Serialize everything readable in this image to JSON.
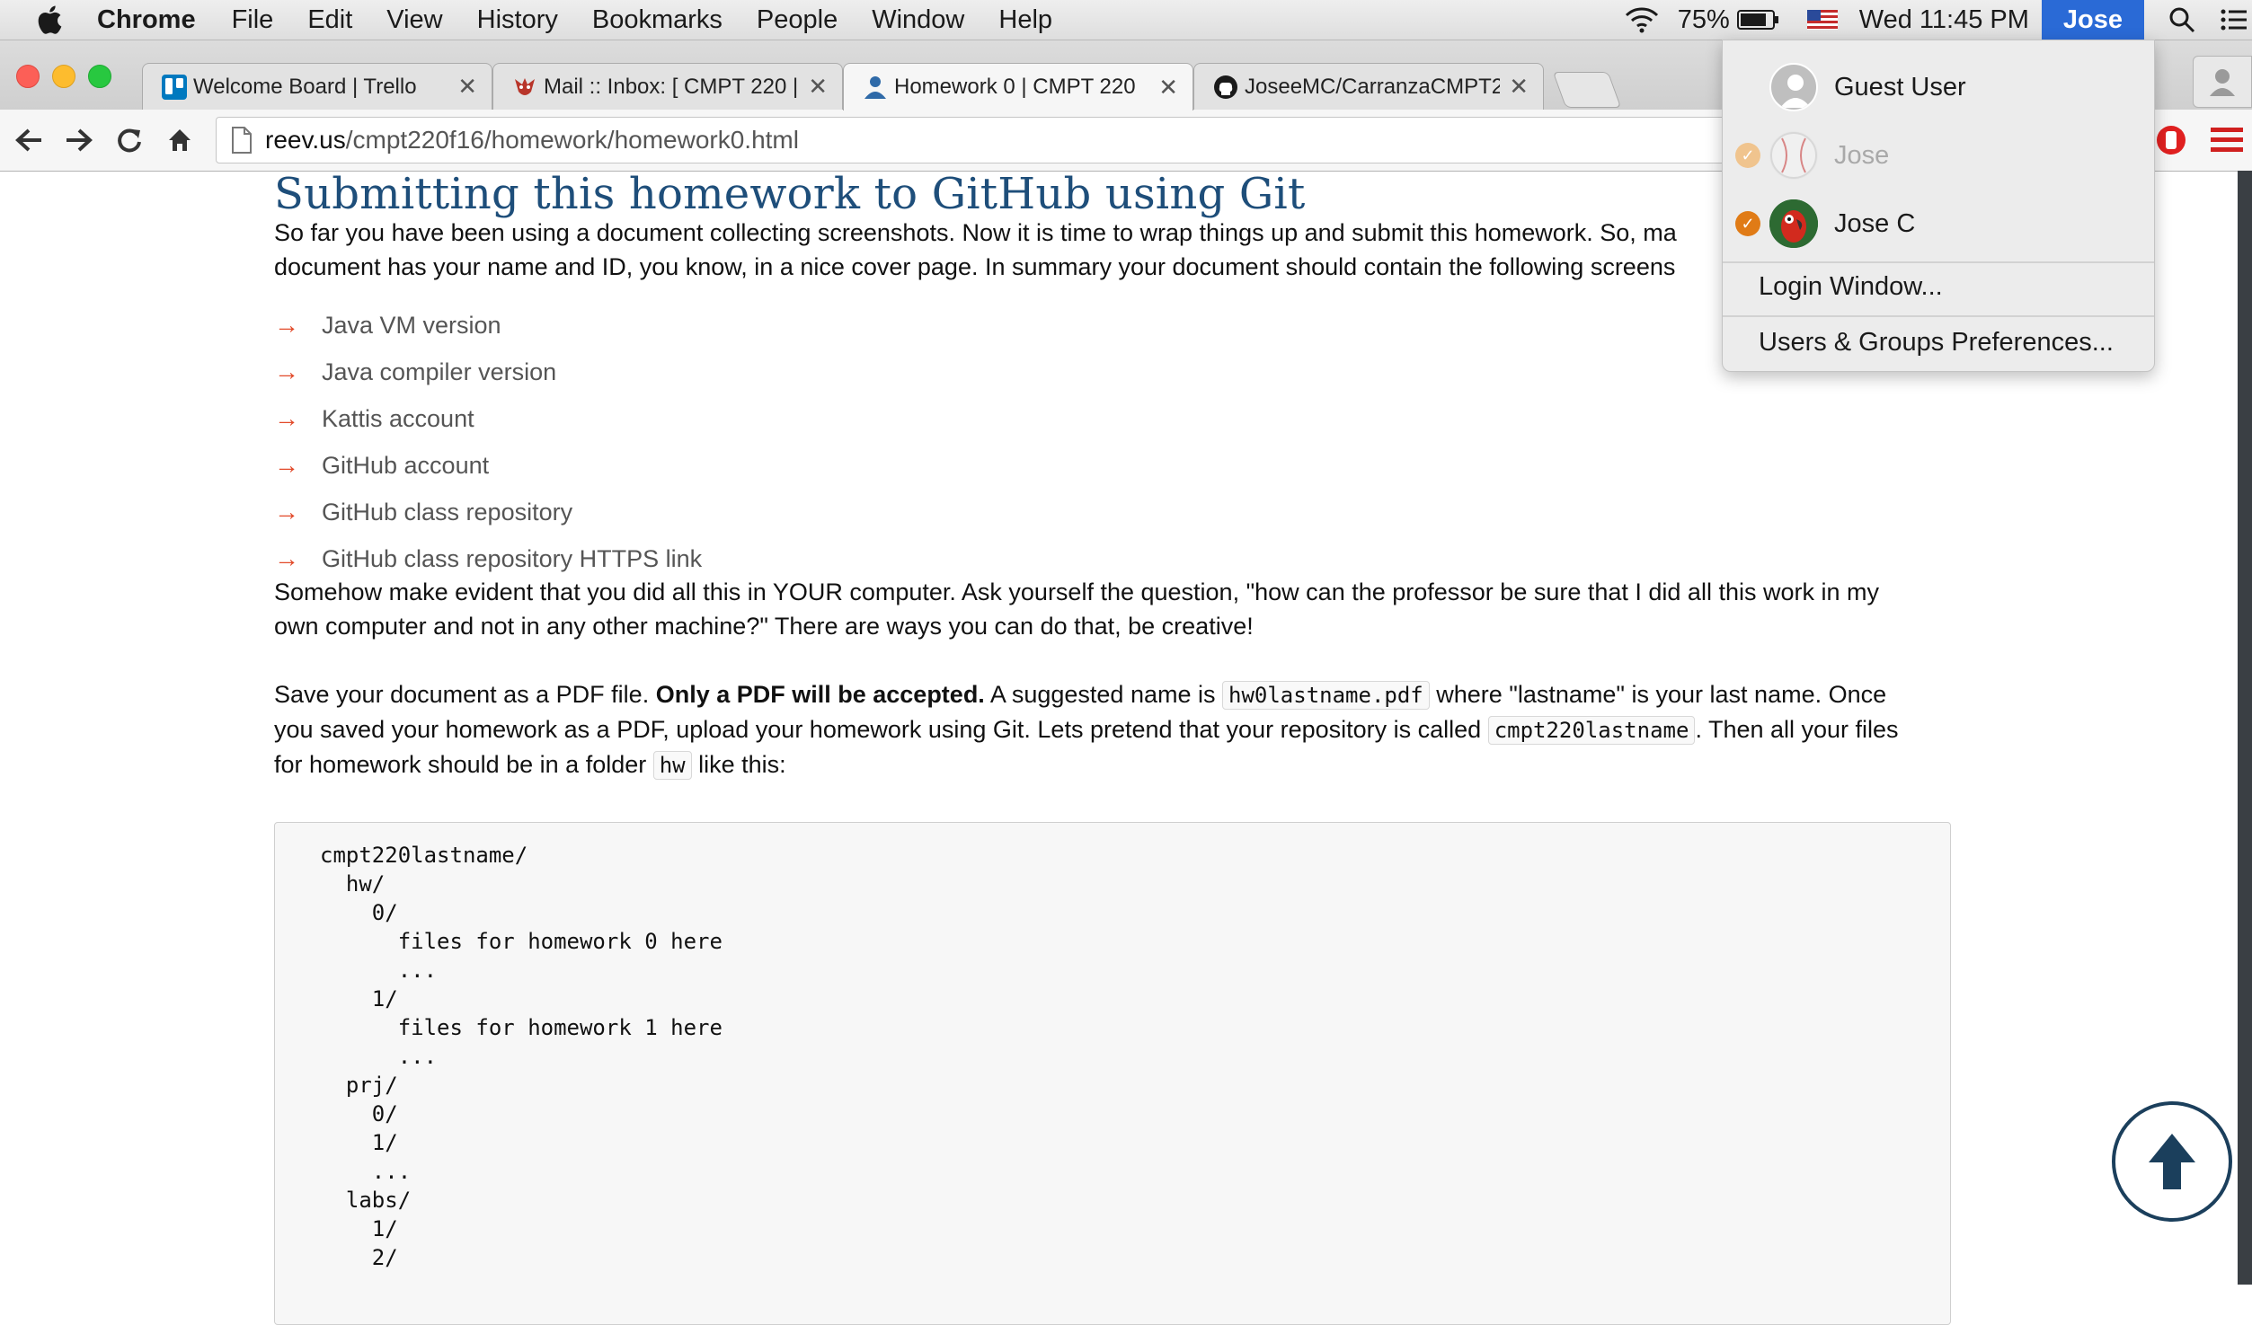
{
  "menubar": {
    "app": "Chrome",
    "items": [
      "File",
      "Edit",
      "View",
      "History",
      "Bookmarks",
      "People",
      "Window",
      "Help"
    ],
    "battery": "75%",
    "clock": "Wed 11:45 PM",
    "user": "Jose"
  },
  "tabs": [
    {
      "title": "Welcome Board | Trello",
      "icon": "trello-icon"
    },
    {
      "title": "Mail :: Inbox: [ CMPT 220 |",
      "icon": "roundcube-icon"
    },
    {
      "title": "Homework 0 | CMPT 220",
      "icon": "person-icon"
    },
    {
      "title": "JoseeMC/CarranzaCMPT2:",
      "icon": "github-icon"
    }
  ],
  "omnibox": {
    "host": "reev.us",
    "path": "/cmpt220f16/homework/homework0.html"
  },
  "page": {
    "heading": "Submitting this homework to GitHub using Git",
    "intro_line1": "So far you have been using a document collecting screenshots. Now it is time to wrap things up and submit this homework. So, ma",
    "intro_line2": "document has your name and ID, you know, in a nice cover page. In summary your document should contain the following screens",
    "requirements": [
      "Java VM version",
      "Java compiler version",
      "Kattis account",
      "GitHub account",
      "GitHub class repository",
      "GitHub class repository HTTPS link"
    ],
    "evident_line1": "Somehow make evident that you did all this in YOUR computer. Ask yourself the question, \"how can the professor be sure that I did all this work in my",
    "evident_line2": "own computer and not in any other machine?\" There are ways you can do that, be creative!",
    "save_a": "Save your document as a PDF file. ",
    "save_bold": "Only a PDF will be accepted.",
    "save_b": " A suggested name is ",
    "save_code1": "hw0lastname.pdf",
    "save_c": " where \"lastname\" is your last name. Once",
    "save_d": "you saved your homework as a PDF, upload your homework using Git. Lets pretend that your repository is called ",
    "save_code2": "cmpt220lastname",
    "save_e": ". Then all your files",
    "save_f": "for homework should be in a folder ",
    "save_code3": "hw",
    "save_g": " like this:",
    "code": "cmpt220lastname/\n  hw/\n    0/\n      files for homework 0 here\n      ...\n    1/\n      files for homework 1 here\n      ...\n  prj/\n    0/\n    1/\n    ...\n  labs/\n    1/\n    2/"
  },
  "user_menu": {
    "users": [
      {
        "name": "Guest User",
        "state": "none"
      },
      {
        "name": "Jose",
        "state": "dimmed"
      },
      {
        "name": "Jose C",
        "state": "active"
      }
    ],
    "login_window": "Login Window...",
    "preferences": "Users & Groups Preferences..."
  },
  "colors": {
    "heading": "#1e4e7a",
    "arrow": "#e24a2a",
    "menubar_user": "#2a6ad6",
    "check": "#e07b16"
  }
}
